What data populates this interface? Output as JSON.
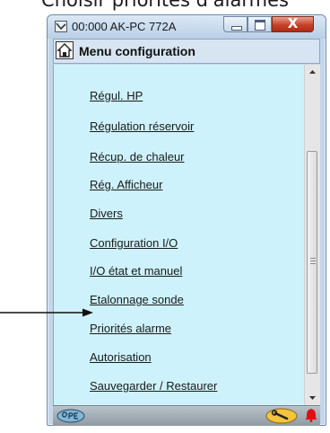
{
  "caption": "Choisir priorités d'alarmes",
  "window": {
    "title": "00:000 AK-PC 772A",
    "close_glyph": "X"
  },
  "header": {
    "title": "Menu configuration",
    "icon": "home-icon"
  },
  "menu": {
    "items": [
      {
        "label": "Régul. HP"
      },
      {
        "label": "Régulation réservoir"
      },
      {
        "label": "Récup. de chaleur"
      },
      {
        "label": "Rég. Afficheur"
      },
      {
        "label": "Divers"
      },
      {
        "label": "Configuration I/O"
      },
      {
        "label": "I/O  état et manuel"
      },
      {
        "label": "Etalonnage sonde"
      },
      {
        "label": "Priorités alarme"
      },
      {
        "label": "Autorisation"
      },
      {
        "label": "Sauvegarder / Restaurer"
      }
    ]
  },
  "footer": {
    "icons": [
      "operator-icon",
      "wrench-icon",
      "alarm-bell-icon"
    ]
  },
  "colors": {
    "content_bg": "#cdf2fb",
    "titlebar": "#c3d6ea",
    "close_button": "#c7412a",
    "alarm": "#e01010"
  }
}
